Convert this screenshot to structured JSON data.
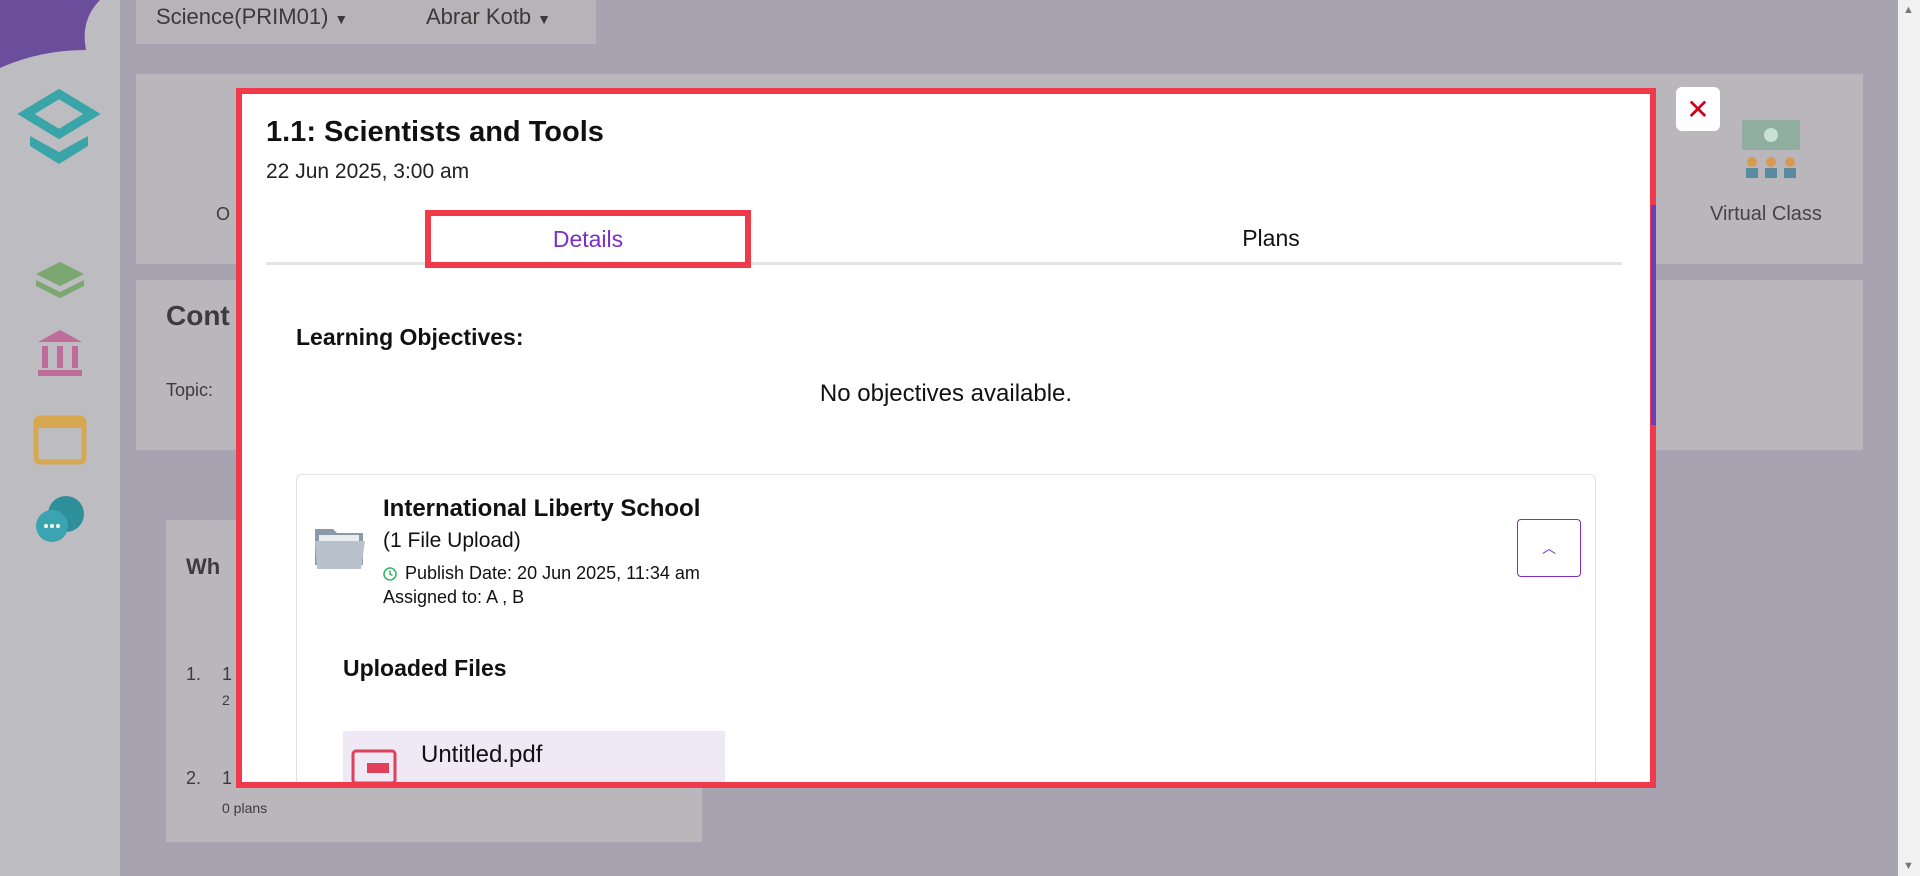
{
  "background": {
    "breadcrumbs": [
      {
        "label": "Science(PRIM01)"
      },
      {
        "label": "Abrar Kotb"
      }
    ],
    "ghost_texts": {
      "panel1_left": "O",
      "panel2_title": "Cont",
      "panel2_topic": "Topic:",
      "panel3_title": "Wh",
      "item1_num": "1.",
      "item1_text": "1",
      "item1_sub": "2",
      "item2_num": "2.",
      "item2_text": "1",
      "item2_sub": "0 plans"
    },
    "virtual_class_label": "Virtual Class"
  },
  "modal": {
    "title": "1.1: Scientists and Tools",
    "date": "22 Jun 2025, 3:00 am",
    "close_icon": "close-icon",
    "tabs": [
      {
        "label": "Details",
        "active": true
      },
      {
        "label": "Plans",
        "active": false
      }
    ],
    "learning_objectives_label": "Learning Objectives:",
    "no_objectives_text": "No objectives available.",
    "card": {
      "title": "International Liberty School",
      "subtitle": "(1 File Upload)",
      "publish_date": "Publish Date: 20 Jun 2025, 11:34 am",
      "assigned_to": "Assigned to: A , B",
      "toggle_icon": "chevron-up-icon",
      "uploaded_files_label": "Uploaded Files",
      "files": [
        {
          "name": "Untitled.pdf",
          "icon": "pdf-icon"
        }
      ]
    }
  },
  "colors": {
    "accent": "#7b2ec8",
    "highlight_border": "#f0394a",
    "close_icon": "#d0021b"
  }
}
